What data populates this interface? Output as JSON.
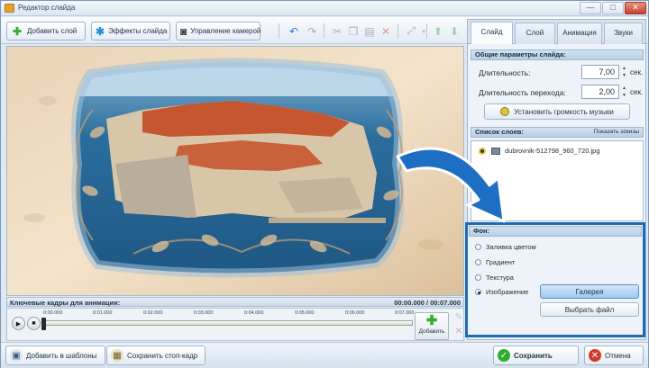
{
  "window": {
    "title": "Редактор слайда",
    "minimize": "—",
    "maximize": "□",
    "close": "✕"
  },
  "toolbar": {
    "add_layer": "Добавить слой",
    "slide_effects": "Эффекты слайда",
    "camera_control": "Управление камерой"
  },
  "keyframes": {
    "label": "Ключевые кадры для анимации:",
    "time": "00:00.000 / 00:07.000",
    "ticks": [
      "0:00.000",
      "0:01.000",
      "0:02.000",
      "0:03.000",
      "0:04.000",
      "0:05.000",
      "0:06.000",
      "0:07.000"
    ],
    "add_label": "Добавить"
  },
  "bottom": {
    "add_to_templates": "Добавить в шаблоны",
    "save_frame": "Сохранить стоп-кадр",
    "save": "Сохранить",
    "cancel": "Отмена"
  },
  "tabs": [
    "Слайд",
    "Слой",
    "Анимация",
    "Звуки"
  ],
  "slide_params": {
    "header": "Общие параметры слайда:",
    "duration_label": "Длительность:",
    "duration_value": "7,00",
    "transition_label": "Длительность перехода:",
    "transition_value": "2,00",
    "unit": "сек.",
    "music_button": "Установить громкость музыки"
  },
  "layers": {
    "header": "Список слоев:",
    "show_thumbs": "Показать эскизы",
    "items": [
      "dubrovnik-512798_960_720.jpg"
    ]
  },
  "background": {
    "header": "Фон:",
    "options": [
      "Заливка цветом",
      "Градиент",
      "Текстура",
      "Изображение"
    ],
    "selected_index": 3,
    "gallery_button": "Галерея",
    "choose_file_button": "Выбрать файл"
  },
  "colors": {
    "accent": "#1f6bb3",
    "save": "#2eae2e",
    "cancel": "#d23a2a"
  }
}
